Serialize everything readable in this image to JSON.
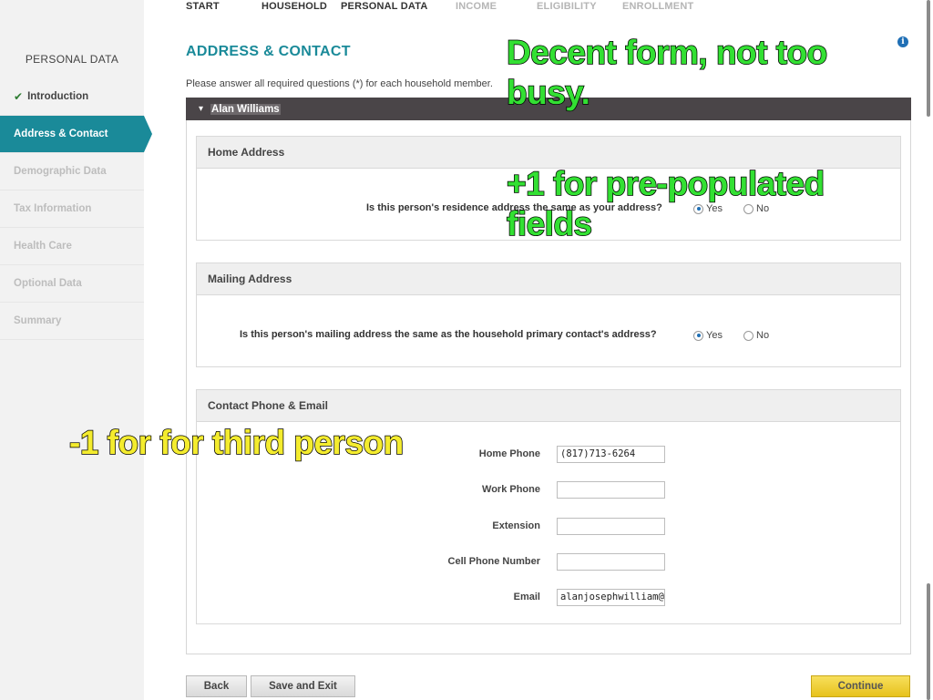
{
  "nav": {
    "steps": [
      {
        "label": "START",
        "state": "done"
      },
      {
        "label": "HOUSEHOLD",
        "state": "done"
      },
      {
        "label": "PERSONAL DATA",
        "state": "current"
      },
      {
        "label": "INCOME",
        "state": "future"
      },
      {
        "label": "ELIGIBILITY",
        "state": "future"
      },
      {
        "label": "ENROLLMENT",
        "state": "future"
      }
    ]
  },
  "sidebar": {
    "title": "PERSONAL DATA",
    "items": [
      {
        "label": "Introduction",
        "state": "done"
      },
      {
        "label": "Address & Contact",
        "state": "active"
      },
      {
        "label": "Demographic Data",
        "state": "disabled"
      },
      {
        "label": "Tax Information",
        "state": "disabled"
      },
      {
        "label": "Health Care",
        "state": "disabled"
      },
      {
        "label": "Optional Data",
        "state": "disabled"
      },
      {
        "label": "Summary",
        "state": "disabled"
      }
    ]
  },
  "header": {
    "title": "ADDRESS & CONTACT",
    "instructions": "Please answer all required questions (*) for each household member.",
    "info_icon": "info-icon"
  },
  "person": {
    "name": "Alan Williams",
    "chevron": "▾"
  },
  "sections": {
    "home": {
      "title": "Home Address",
      "question": "Is this person's residence address the same as your address?",
      "yes": "Yes",
      "no": "No",
      "selected": "Yes"
    },
    "mailing": {
      "title": "Mailing Address",
      "question": "Is this person's mailing address the same as the household primary contact's address?",
      "yes": "Yes",
      "no": "No",
      "selected": "Yes"
    },
    "contact": {
      "title": "Contact Phone & Email",
      "fields": [
        {
          "label": "Home Phone",
          "value": "(817)713-6264"
        },
        {
          "label": "Work Phone",
          "value": ""
        },
        {
          "label": "Extension",
          "value": ""
        },
        {
          "label": "Cell Phone Number",
          "value": ""
        },
        {
          "label": "Email",
          "value": "alanjosephwilliam@g"
        }
      ]
    }
  },
  "buttons": {
    "back": "Back",
    "save_exit": "Save and Exit",
    "continue": "Continue"
  },
  "annotations": {
    "note1": "Decent form, not too\nbusy.",
    "note2": "+1 for pre-populated\nfields",
    "note3": "-1 for for third person"
  },
  "colors": {
    "accent": "#1a8a99",
    "person_bar": "#4a4548",
    "continue_button": "#e9c623",
    "annotation_green": "#33e033",
    "annotation_yellow": "#f4ec2e"
  }
}
